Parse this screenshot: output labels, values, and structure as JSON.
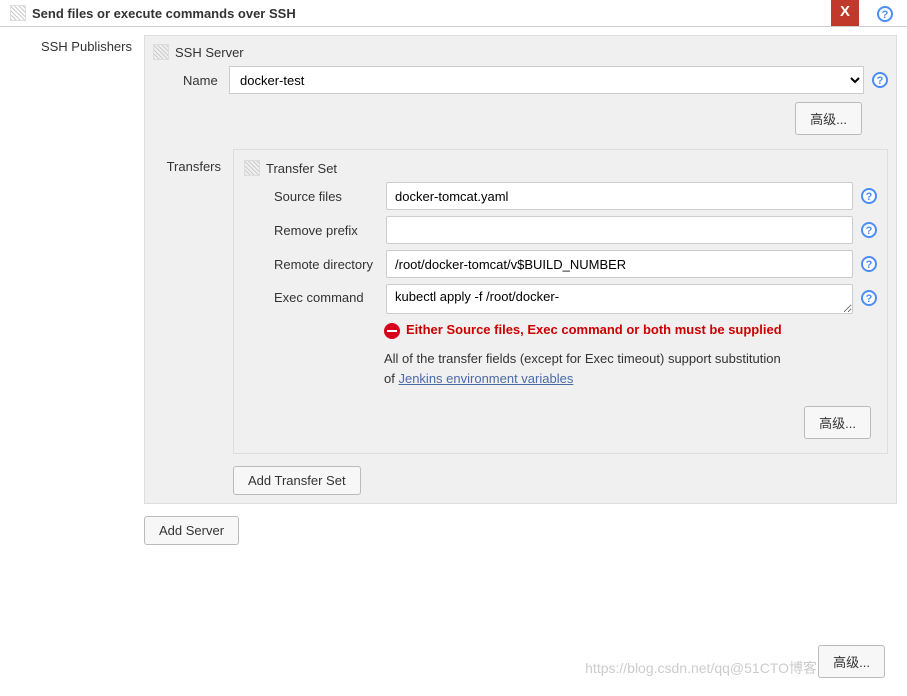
{
  "header": {
    "title": "Send files or execute commands over SSH",
    "close": "X"
  },
  "leftLabel": "SSH Publishers",
  "sshServer": {
    "heading": "SSH Server",
    "nameLabel": "Name",
    "nameValue": "docker-test",
    "advancedLabel": "高级..."
  },
  "transfers": {
    "label": "Transfers",
    "setHeading": "Transfer Set",
    "sourceLabel": "Source files",
    "sourceValue": "docker-tomcat.yaml",
    "removePrefixLabel": "Remove prefix",
    "removePrefixValue": "",
    "remoteDirLabel": "Remote directory",
    "remoteDirValue": "/root/docker-tomcat/v$BUILD_NUMBER",
    "execLabel": "Exec command",
    "execValue": "kubectl apply -f /root/docker-",
    "errorText": "Either Source files, Exec command or both must be supplied",
    "hintPrefix": "All of the transfer fields (except for Exec timeout) support substitution of ",
    "hintLink": "Jenkins environment variables",
    "advancedLabel": "高级...",
    "addTransferSet": "Add Transfer Set"
  },
  "addServer": "Add Server",
  "bottomAdvanced": "高级...",
  "watermark": "https://blog.csdn.net/qq@51CTO博客"
}
